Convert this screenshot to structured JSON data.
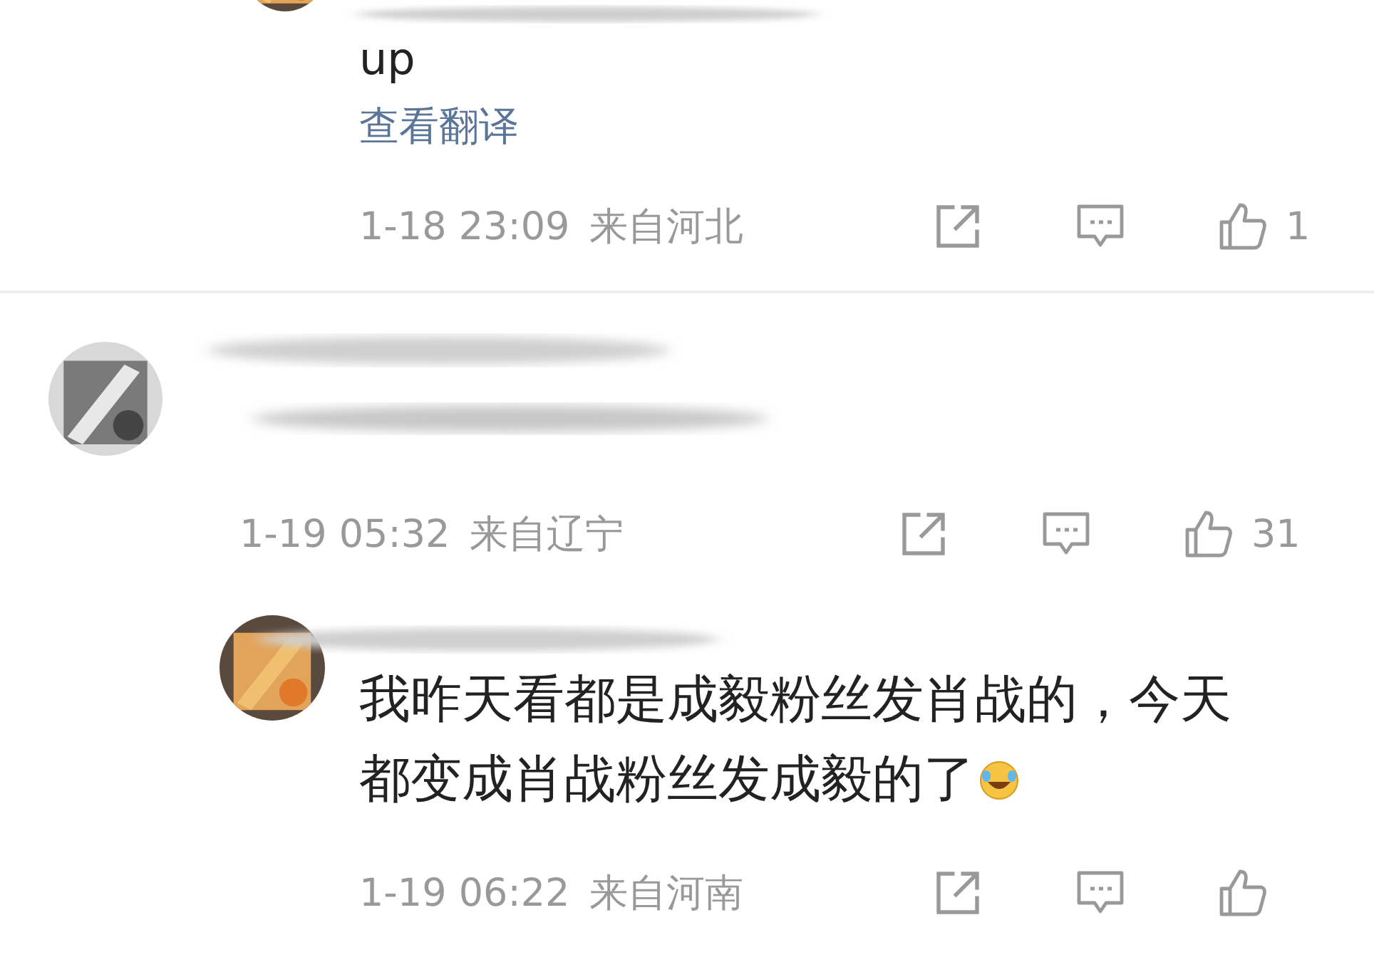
{
  "comments": [
    {
      "kind": "reply",
      "text": "up",
      "translate_link": "查看翻译",
      "time": "1-18 23:09",
      "location": "来自河北",
      "likes": "1"
    },
    {
      "kind": "comment",
      "time": "1-19 05:32",
      "location": "来自辽宁",
      "likes": "31"
    },
    {
      "kind": "reply",
      "text": "我昨天看都是成毅粉丝发肖战的，今天都变成肖战粉丝发成毅的了",
      "emoji": true,
      "time": "1-19 06:22",
      "location": "来自河南"
    }
  ]
}
